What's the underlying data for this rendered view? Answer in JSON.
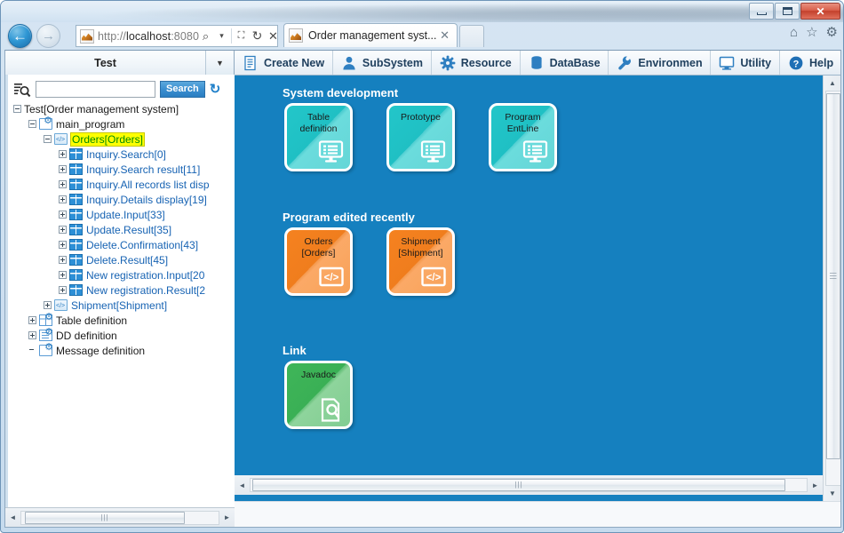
{
  "window": {
    "minimize_label": "Minimize",
    "maximize_label": "Maximize",
    "close_label": "✕"
  },
  "browser": {
    "back_label": "←",
    "forward_label": "→",
    "url_scheme": "http://",
    "url_host": "localhost",
    "url_port": ":8080",
    "address_icons": [
      "search-icon",
      "dropdown-arrow-icon",
      "compatibility-view-icon",
      "refresh-icon",
      "stop-icon"
    ],
    "search_glyph": "⌕",
    "dropdown_glyph": "▾",
    "compat_glyph": "⛶",
    "refresh_glyph": "↻",
    "stop_glyph": "✕",
    "tab": {
      "title": "Order management syst...",
      "close_glyph": "✕"
    },
    "tools": {
      "home_glyph": "⌂",
      "favorites_glyph": "☆",
      "settings_glyph": "⚙"
    }
  },
  "tree_panel": {
    "tab_title": "Test",
    "menu_glyph": "▼",
    "search": {
      "value": "",
      "placeholder": "",
      "button_label": "Search",
      "refresh_glyph": "↻"
    },
    "nodes": [
      {
        "label": "Test[Order management system]",
        "indent": 0,
        "expander": "minus",
        "icon": "none",
        "style": "plain"
      },
      {
        "label": "main_program",
        "indent": 1,
        "expander": "minus",
        "icon": "folder",
        "style": "plain"
      },
      {
        "label": "Orders[Orders]",
        "indent": 2,
        "expander": "minus",
        "icon": "page",
        "style": "highlight"
      },
      {
        "label": "Inquiry.Search[0]",
        "indent": 3,
        "expander": "plus",
        "icon": "grid",
        "style": "link"
      },
      {
        "label": "Inquiry.Search result[11]",
        "indent": 3,
        "expander": "plus",
        "icon": "grid",
        "style": "link"
      },
      {
        "label": "Inquiry.All records list disp",
        "indent": 3,
        "expander": "plus",
        "icon": "grid",
        "style": "link"
      },
      {
        "label": "Inquiry.Details display[19]",
        "indent": 3,
        "expander": "plus",
        "icon": "grid",
        "style": "link"
      },
      {
        "label": "Update.Input[33]",
        "indent": 3,
        "expander": "plus",
        "icon": "grid",
        "style": "link"
      },
      {
        "label": "Update.Result[35]",
        "indent": 3,
        "expander": "plus",
        "icon": "grid",
        "style": "link"
      },
      {
        "label": "Delete.Confirmation[43]",
        "indent": 3,
        "expander": "plus",
        "icon": "grid",
        "style": "link"
      },
      {
        "label": "Delete.Result[45]",
        "indent": 3,
        "expander": "plus",
        "icon": "grid",
        "style": "link"
      },
      {
        "label": "New registration.Input[20",
        "indent": 3,
        "expander": "plus",
        "icon": "grid",
        "style": "link"
      },
      {
        "label": "New registration.Result[2",
        "indent": 3,
        "expander": "plus",
        "icon": "grid",
        "style": "link"
      },
      {
        "label": "Shipment[Shipment]",
        "indent": 2,
        "expander": "plus",
        "icon": "page",
        "style": "link"
      },
      {
        "label": "Table definition",
        "indent": 1,
        "expander": "plus",
        "icon": "tabledef",
        "style": "plain"
      },
      {
        "label": "DD definition",
        "indent": 1,
        "expander": "plus",
        "icon": "dd",
        "style": "plain"
      },
      {
        "label": "Message definition",
        "indent": 1,
        "expander": "none",
        "icon": "msg",
        "style": "plain"
      }
    ],
    "hscroll": {
      "left_glyph": "◄",
      "right_glyph": "►",
      "grip": "⫿"
    }
  },
  "menubar": {
    "items": [
      {
        "label": "Create New",
        "icon": "document-icon"
      },
      {
        "label": "SubSystem",
        "icon": "user-icon"
      },
      {
        "label": "Resource",
        "icon": "gear-icon"
      },
      {
        "label": "DataBase",
        "icon": "database-icon"
      },
      {
        "label": "Environmen",
        "icon": "wrench-icon"
      },
      {
        "label": "Utility",
        "icon": "monitor-icon"
      },
      {
        "label": "Help",
        "icon": "help-icon"
      }
    ]
  },
  "content": {
    "background_color": "#1580bf",
    "sections": [
      {
        "title": "System development",
        "color": "teal",
        "cards": [
          {
            "lines": [
              "Table",
              "definition"
            ],
            "icon": "monitor-list-icon"
          },
          {
            "lines": [
              "Prototype"
            ],
            "icon": "monitor-list-icon"
          },
          {
            "lines": [
              "Program",
              "EntLine"
            ],
            "icon": "monitor-list-icon"
          }
        ]
      },
      {
        "title": "Program edited recently",
        "color": "orange",
        "cards": [
          {
            "lines": [
              "Orders",
              "[Orders]"
            ],
            "icon": "code-icon"
          },
          {
            "lines": [
              "Shipment",
              "[Shipment]"
            ],
            "icon": "code-icon"
          }
        ]
      },
      {
        "title": "Link",
        "color": "green",
        "cards": [
          {
            "lines": [
              "Javadoc"
            ],
            "icon": "doc-search-icon"
          }
        ]
      }
    ]
  },
  "scrollbars": {
    "up_glyph": "▲",
    "down_glyph": "▼",
    "left_glyph": "◄",
    "right_glyph": "►",
    "grip": "⫿"
  }
}
